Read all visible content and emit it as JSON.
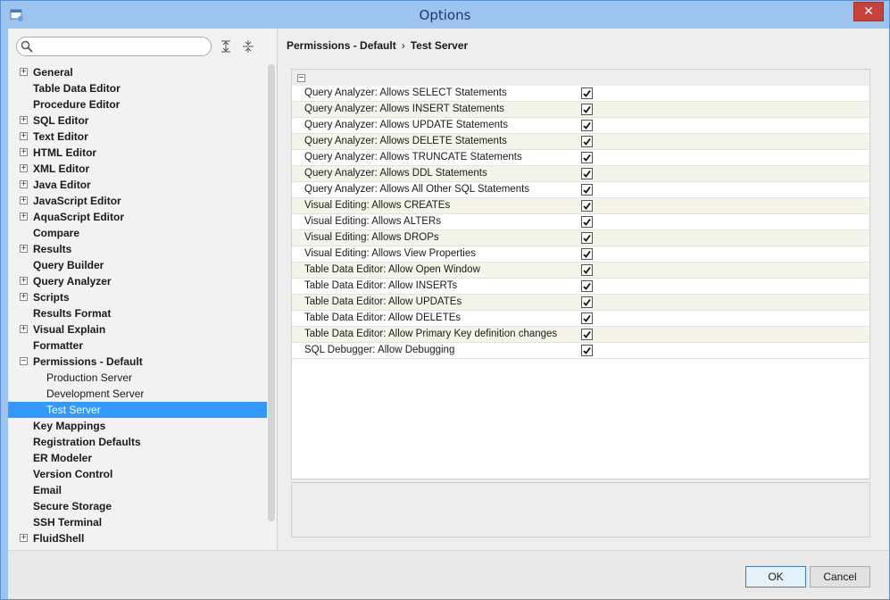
{
  "window": {
    "title": "Options"
  },
  "left": {
    "search": {
      "placeholder": "",
      "value": ""
    },
    "tree": [
      {
        "label": "General",
        "expandable": true,
        "level": 0
      },
      {
        "label": "Table Data Editor",
        "expandable": false,
        "level": 0
      },
      {
        "label": "Procedure Editor",
        "expandable": false,
        "level": 0
      },
      {
        "label": "SQL Editor",
        "expandable": true,
        "level": 0
      },
      {
        "label": "Text Editor",
        "expandable": true,
        "level": 0
      },
      {
        "label": "HTML Editor",
        "expandable": true,
        "level": 0
      },
      {
        "label": "XML Editor",
        "expandable": true,
        "level": 0
      },
      {
        "label": "Java Editor",
        "expandable": true,
        "level": 0
      },
      {
        "label": "JavaScript Editor",
        "expandable": true,
        "level": 0
      },
      {
        "label": "AquaScript Editor",
        "expandable": true,
        "level": 0
      },
      {
        "label": "Compare",
        "expandable": false,
        "level": 0
      },
      {
        "label": "Results",
        "expandable": true,
        "level": 0
      },
      {
        "label": "Query Builder",
        "expandable": false,
        "level": 0
      },
      {
        "label": "Query Analyzer",
        "expandable": true,
        "level": 0
      },
      {
        "label": "Scripts",
        "expandable": true,
        "level": 0
      },
      {
        "label": "Results Format",
        "expandable": false,
        "level": 0
      },
      {
        "label": "Visual Explain",
        "expandable": true,
        "level": 0
      },
      {
        "label": "Formatter",
        "expandable": false,
        "level": 0
      },
      {
        "label": "Permissions - Default",
        "expandable": true,
        "expanded": true,
        "level": 0
      },
      {
        "label": "Production Server",
        "expandable": false,
        "level": 1
      },
      {
        "label": "Development Server",
        "expandable": false,
        "level": 1
      },
      {
        "label": "Test Server",
        "expandable": false,
        "level": 1,
        "selected": true
      },
      {
        "label": "Key Mappings",
        "expandable": false,
        "level": 0
      },
      {
        "label": "Registration Defaults",
        "expandable": false,
        "level": 0
      },
      {
        "label": "ER Modeler",
        "expandable": false,
        "level": 0
      },
      {
        "label": "Version Control",
        "expandable": false,
        "level": 0
      },
      {
        "label": "Email",
        "expandable": false,
        "level": 0
      },
      {
        "label": "Secure Storage",
        "expandable": false,
        "level": 0
      },
      {
        "label": "SSH Terminal",
        "expandable": false,
        "level": 0
      },
      {
        "label": "FluidShell",
        "expandable": true,
        "level": 0
      }
    ]
  },
  "right": {
    "breadcrumb": {
      "parent": "Permissions - Default",
      "separator": "›",
      "current": "Test Server"
    },
    "rows": [
      {
        "label": "Query Analyzer: Allows SELECT Statements",
        "checked": true
      },
      {
        "label": "Query Analyzer: Allows INSERT Statements",
        "checked": true
      },
      {
        "label": "Query Analyzer: Allows UPDATE Statements",
        "checked": true
      },
      {
        "label": "Query Analyzer: Allows DELETE Statements",
        "checked": true
      },
      {
        "label": "Query Analyzer: Allows TRUNCATE Statements",
        "checked": true
      },
      {
        "label": "Query Analyzer: Allows DDL Statements",
        "checked": true
      },
      {
        "label": "Query Analyzer: Allows All Other SQL Statements",
        "checked": true
      },
      {
        "label": "Visual Editing: Allows CREATEs",
        "checked": true
      },
      {
        "label": "Visual Editing: Allows ALTERs",
        "checked": true
      },
      {
        "label": "Visual Editing: Allows DROPs",
        "checked": true
      },
      {
        "label": "Visual Editing: Allows View Properties",
        "checked": true
      },
      {
        "label": "Table Data Editor: Allow Open Window",
        "checked": true
      },
      {
        "label": "Table Data Editor: Allow INSERTs",
        "checked": true
      },
      {
        "label": "Table Data Editor: Allow UPDATEs",
        "checked": true
      },
      {
        "label": "Table Data Editor: Allow DELETEs",
        "checked": true
      },
      {
        "label": "Table Data Editor: Allow Primary Key definition changes",
        "checked": true
      },
      {
        "label": "SQL Debugger: Allow Debugging",
        "checked": true
      }
    ]
  },
  "buttons": {
    "ok": "OK",
    "cancel": "Cancel"
  },
  "icons": {
    "app": "app-icon",
    "close": "close-icon",
    "search": "search-icon",
    "expand_all": "expand-all-icon",
    "collapse_all": "collapse-all-icon"
  }
}
